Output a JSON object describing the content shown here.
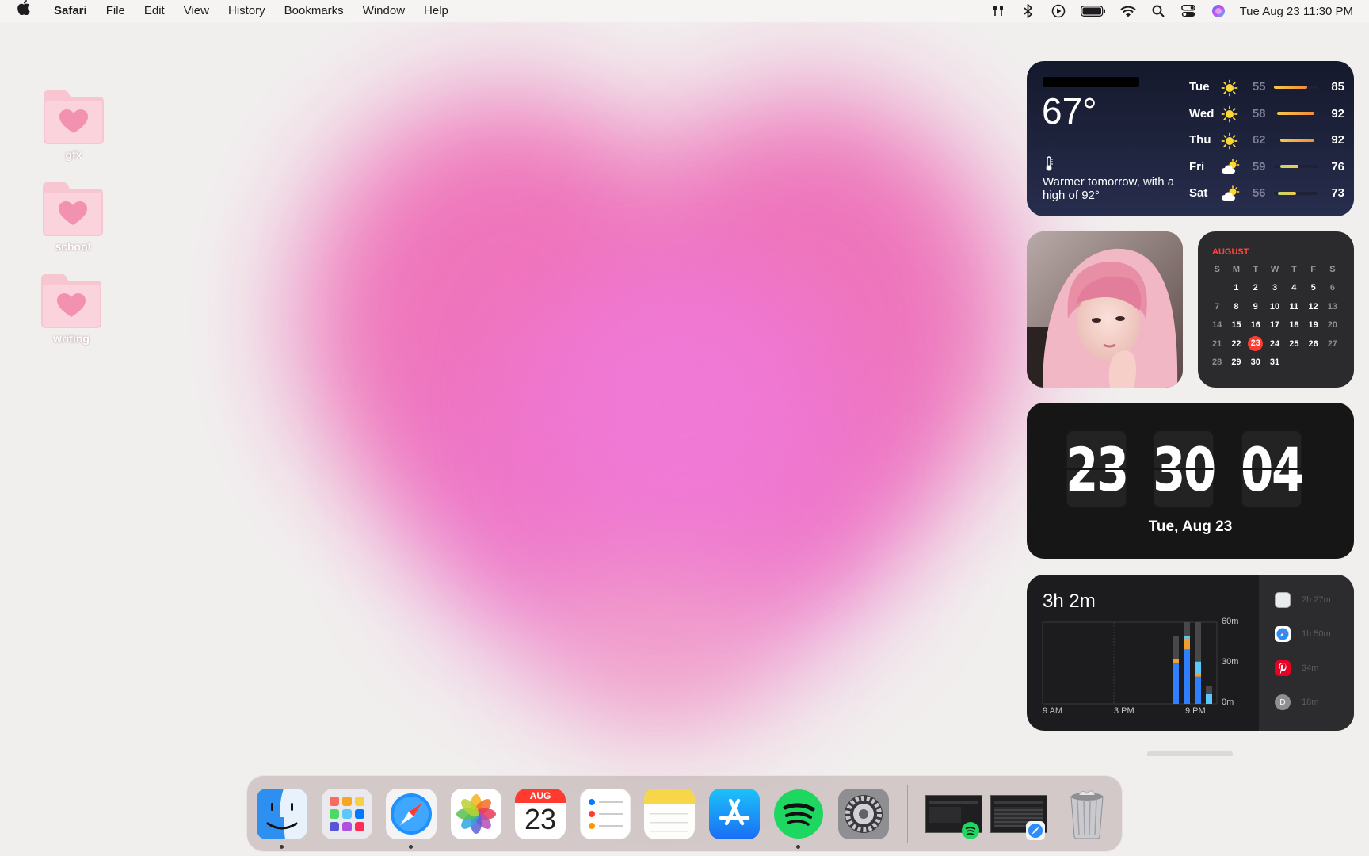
{
  "menubar": {
    "app_name": "Safari",
    "menus": [
      "File",
      "Edit",
      "View",
      "History",
      "Bookmarks",
      "Window",
      "Help"
    ],
    "clock": "Tue Aug 23  11:30 PM",
    "status_icons": [
      "airpods-icon",
      "bluetooth-icon",
      "now-playing-icon",
      "battery-icon",
      "wifi-icon",
      "spotlight-search-icon",
      "control-center-icon",
      "siri-icon"
    ]
  },
  "desktop": {
    "folders": [
      {
        "label": "gfx",
        "icon": "heart-folder-icon"
      },
      {
        "label": "school",
        "icon": "heart-folder-icon"
      },
      {
        "label": "writing",
        "icon": "heart-folder-icon"
      }
    ]
  },
  "weather": {
    "temperature": "67°",
    "summary": "Warmer tomorrow, with a high of 92°",
    "forecast": [
      {
        "day": "Tue",
        "icon": "sun-icon",
        "low": "55",
        "high": "85",
        "range": [
          0.0,
          0.75
        ]
      },
      {
        "day": "Wed",
        "icon": "sun-icon",
        "low": "58",
        "high": "92",
        "range": [
          0.08,
          0.9
        ]
      },
      {
        "day": "Thu",
        "icon": "sun-icon",
        "low": "62",
        "high": "92",
        "range": [
          0.15,
          0.9
        ]
      },
      {
        "day": "Fri",
        "icon": "partly-cloudy-icon",
        "low": "59",
        "high": "76",
        "range": [
          0.15,
          0.55
        ]
      },
      {
        "day": "Sat",
        "icon": "partly-cloudy-icon",
        "low": "56",
        "high": "73",
        "range": [
          0.1,
          0.5
        ]
      }
    ],
    "colors": {
      "hot": "#f5893a",
      "warm": "#f3c94c",
      "mild": "#c3d86a"
    }
  },
  "calendar": {
    "month": "AUGUST",
    "weekday_headers": [
      "S",
      "M",
      "T",
      "W",
      "T",
      "F",
      "S"
    ],
    "weeks": [
      [
        "",
        "1",
        "2",
        "3",
        "4",
        "5",
        "6"
      ],
      [
        "7",
        "8",
        "9",
        "10",
        "11",
        "12",
        "13"
      ],
      [
        "14",
        "15",
        "16",
        "17",
        "18",
        "19",
        "20"
      ],
      [
        "21",
        "22",
        "23",
        "24",
        "25",
        "26",
        "27"
      ],
      [
        "28",
        "29",
        "30",
        "31",
        "",
        "",
        ""
      ]
    ],
    "today": "23",
    "today_color": "#ff3b30"
  },
  "flip_clock": {
    "hours": "23",
    "minutes": "30",
    "seconds": "04",
    "date": "Tue, Aug 23"
  },
  "screen_time": {
    "total": "3h 2m",
    "y_labels": [
      "60m",
      "30m",
      "0m"
    ],
    "x_labels": [
      "9 AM",
      "3 PM",
      "9 PM"
    ],
    "apps": [
      {
        "icon": "app-generic-icon",
        "time": "2h 27m"
      },
      {
        "icon": "safari-icon",
        "time": "1h 50m"
      },
      {
        "icon": "pinterest-icon",
        "time": "34m"
      },
      {
        "icon": "app-d-icon",
        "letter": "D",
        "time": "18m"
      }
    ],
    "hourly_minutes": [
      {
        "hour": "8 PM",
        "blue": 30,
        "orange": 3,
        "cyan": 0,
        "total": 50
      },
      {
        "hour": "9 PM",
        "blue": 40,
        "orange": 8,
        "cyan": 2,
        "total": 60
      },
      {
        "hour": "10 PM",
        "blue": 20,
        "orange": 2,
        "cyan": 9,
        "total": 60
      },
      {
        "hour": "11 PM",
        "blue": 0,
        "orange": 0,
        "cyan": 7,
        "total": 13
      }
    ],
    "colors": {
      "blue": "#2f80ff",
      "orange": "#f0a030",
      "cyan": "#5ac8fa",
      "other": "#48484a"
    }
  },
  "dock": {
    "apps": [
      {
        "name": "Finder",
        "icon": "finder-icon",
        "running": true
      },
      {
        "name": "Launchpad",
        "icon": "launchpad-icon",
        "running": false
      },
      {
        "name": "Safari",
        "icon": "safari-icon",
        "running": true
      },
      {
        "name": "Photos",
        "icon": "photos-icon",
        "running": false
      },
      {
        "name": "Calendar",
        "icon": "calendar-icon",
        "running": false,
        "month": "AUG",
        "day": "23"
      },
      {
        "name": "Reminders",
        "icon": "reminders-icon",
        "running": false
      },
      {
        "name": "Notes",
        "icon": "notes-icon",
        "running": false
      },
      {
        "name": "App Store",
        "icon": "app-store-icon",
        "running": false
      },
      {
        "name": "Spotify",
        "icon": "spotify-icon",
        "running": true
      },
      {
        "name": "System Preferences",
        "icon": "system-preferences-icon",
        "running": false
      }
    ],
    "minimized": [
      "spotify-window-thumbnail",
      "safari-window-thumbnail"
    ],
    "trash": "trash-icon"
  }
}
